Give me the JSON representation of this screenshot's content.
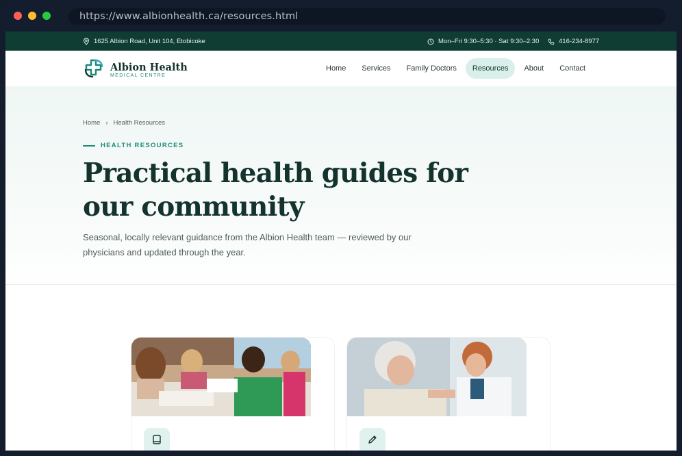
{
  "browser": {
    "url": "https://www.albionhealth.ca/resources.html"
  },
  "topbar": {
    "address": "1625 Albion Road, Unit 104, Etobicoke",
    "hours": "Mon–Fri 9:30–5:30 · Sat 9:30–2:30",
    "phone": "416-234-8977"
  },
  "brand": {
    "name": "Albion Health",
    "tagline": "MEDICAL CENTRE"
  },
  "nav": {
    "items": [
      "Home",
      "Services",
      "Family Doctors",
      "Resources",
      "About",
      "Contact"
    ],
    "active": "Resources"
  },
  "hero": {
    "breadcrumb": {
      "home": "Home",
      "separator": "›",
      "current": "Health Resources"
    },
    "eyebrow": "HEALTH RESOURCES",
    "title": "Practical health guides for our community",
    "lede": "Seasonal, locally relevant guidance from the Albion Health team — reviewed by our physicians and updated through the year."
  },
  "cards": [
    {
      "image": "children-classroom-photo",
      "icon": "book-icon"
    },
    {
      "image": "elderly-patient-vaccination-photo",
      "icon": "pencil-icon"
    }
  ],
  "colors": {
    "brand_dark": "#0f3d34",
    "accent": "#1d8a79",
    "nav_active_bg": "#d9efea",
    "heading": "#14332d"
  }
}
